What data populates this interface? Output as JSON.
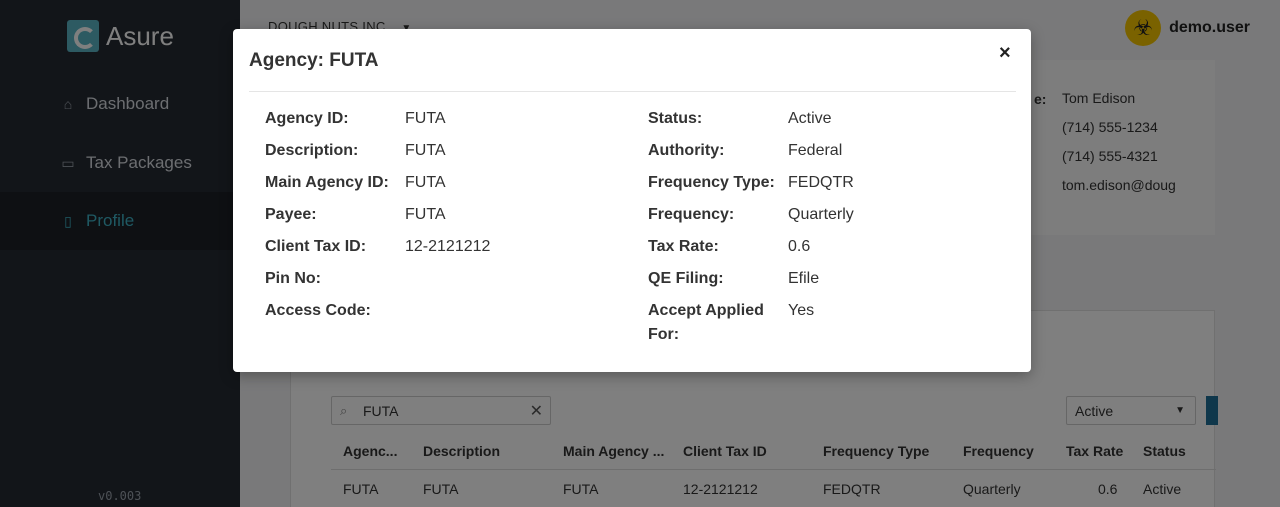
{
  "sidebar": {
    "logo_text": "Asure",
    "items": [
      {
        "label": "Dashboard",
        "icon": "home-icon"
      },
      {
        "label": "Tax Packages",
        "icon": "calendar-icon"
      },
      {
        "label": "Profile",
        "icon": "badge-icon"
      }
    ],
    "version": "v0.003"
  },
  "header": {
    "company": "DOUGH NUTS INC.",
    "username": "demo.user",
    "avatar_icon": "biohazard-icon"
  },
  "contact": {
    "key_label": "e:",
    "lines": [
      "Tom Edison",
      "(714) 555-1234",
      "(714) 555-4321",
      "tom.edison@doug"
    ]
  },
  "table": {
    "search_value": "FUTA",
    "status_filter": "Active",
    "columns": [
      "Agenc...",
      "Description",
      "Main Agency ...",
      "Client Tax ID",
      "Frequency Type",
      "Frequency",
      "Tax Rate",
      "Status"
    ],
    "rows": [
      [
        "FUTA",
        "FUTA",
        "FUTA",
        "12-2121212",
        "FEDQTR",
        "Quarterly",
        "0.6",
        "Active"
      ]
    ]
  },
  "modal": {
    "title": "Agency: FUTA",
    "close_label": "×",
    "left_fields": [
      {
        "label": "Agency ID:",
        "value": "FUTA"
      },
      {
        "label": "Description:",
        "value": "FUTA"
      },
      {
        "label": "Main Agency ID:",
        "value": "FUTA"
      },
      {
        "label": "Payee:",
        "value": "FUTA"
      },
      {
        "label": "Client Tax ID:",
        "value": "12-2121212"
      },
      {
        "label": "Pin No:",
        "value": ""
      },
      {
        "label": "Access Code:",
        "value": ""
      }
    ],
    "right_fields": [
      {
        "label": "Status:",
        "value": "Active"
      },
      {
        "label": "Authority:",
        "value": "Federal"
      },
      {
        "label": "Frequency Type:",
        "value": "FEDQTR"
      },
      {
        "label": "Frequency:",
        "value": "Quarterly"
      },
      {
        "label": "Tax Rate:",
        "value": "0.6"
      },
      {
        "label": "QE Filing:",
        "value": "Efile"
      },
      {
        "label": "Accept Applied",
        "value": "Yes"
      }
    ],
    "right_extra_label": "For:"
  }
}
